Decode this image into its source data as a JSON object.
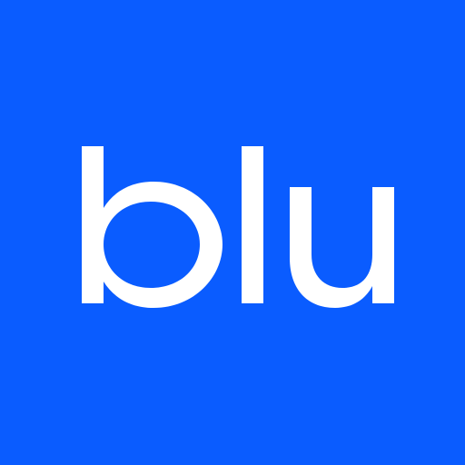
{
  "app_icon": {
    "wordmark": "blu",
    "colors": {
      "background": "#0A5CFF",
      "foreground": "#FFFFFF"
    }
  }
}
